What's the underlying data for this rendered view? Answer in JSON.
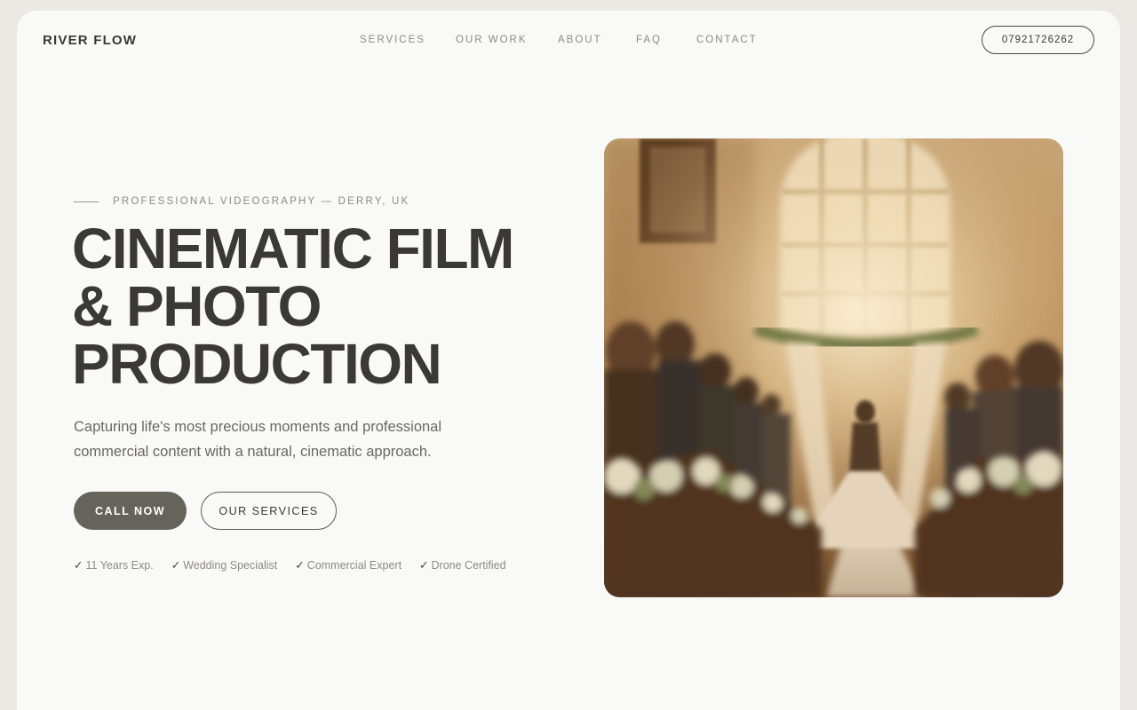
{
  "header": {
    "brand": "RIVER FLOW",
    "nav": [
      "SERVICES",
      "OUR WORK",
      "ABOUT",
      "FAQ",
      "CONTACT"
    ],
    "phone": "07921726262"
  },
  "hero": {
    "eyebrow": "PROFESSIONAL VIDEOGRAPHY — DERRY, UK",
    "headline_lines": [
      "CINEMATIC FILM",
      "& PHOTO",
      "PRODUCTION"
    ],
    "subtext_lines": [
      "Capturing life's most precious moments and professional",
      "commercial content with a natural, cinematic approach."
    ],
    "primary_cta": "CALL NOW",
    "secondary_cta": "OUR SERVICES",
    "badges": [
      {
        "check": "✓",
        "label": "11 Years Exp."
      },
      {
        "check": "✓",
        "label": "Wedding Specialist"
      },
      {
        "check": "✓",
        "label": "Commercial Expert"
      },
      {
        "check": "✓",
        "label": "Drone Certified"
      }
    ],
    "image_subject": "wedding-ceremony-photo"
  },
  "colors": {
    "background": "#f9f9f7",
    "outer": "#ebe9e4",
    "text_dark": "#3a3936",
    "text_muted": "#8d8a84",
    "button_primary": "#66625c"
  }
}
